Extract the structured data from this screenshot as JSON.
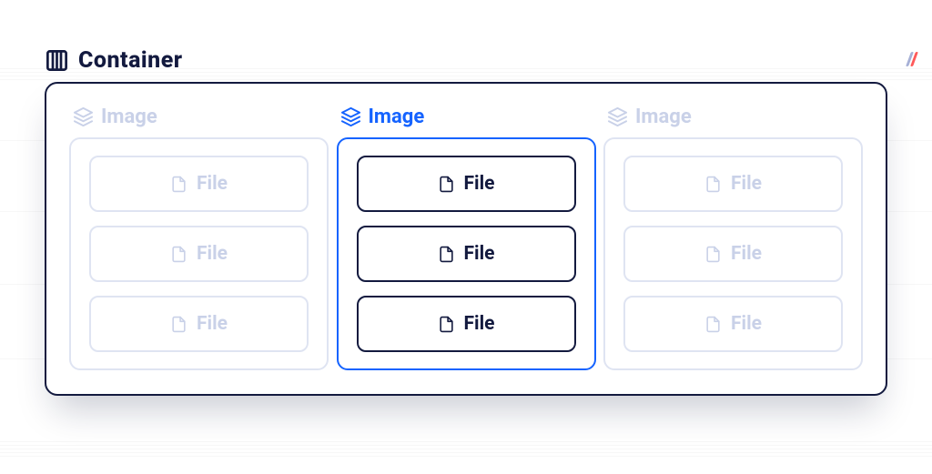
{
  "container": {
    "label": "Container"
  },
  "columns": [
    {
      "label": "Image",
      "active": false,
      "files": [
        "File",
        "File",
        "File"
      ]
    },
    {
      "label": "Image",
      "active": true,
      "files": [
        "File",
        "File",
        "File"
      ]
    },
    {
      "label": "Image",
      "active": false,
      "files": [
        "File",
        "File",
        "File"
      ]
    }
  ]
}
